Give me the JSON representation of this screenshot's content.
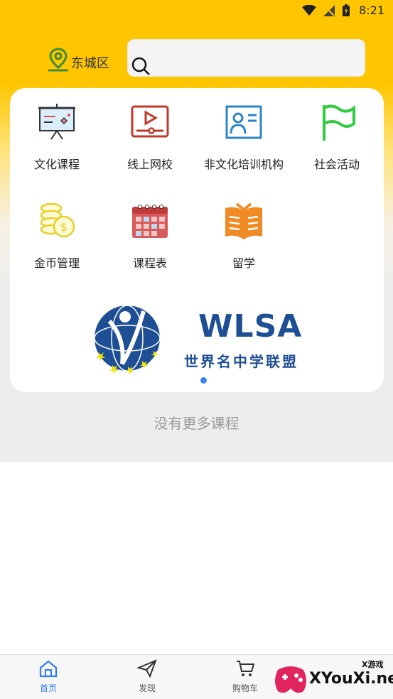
{
  "status": {
    "time": "8:21"
  },
  "header": {
    "location": "东城区",
    "search_placeholder": ""
  },
  "menu": [
    {
      "label": "文化课程",
      "icon": "presentation-board-icon"
    },
    {
      "label": "线上网校",
      "icon": "video-player-icon"
    },
    {
      "label": "非文化培训机构",
      "icon": "id-card-icon"
    },
    {
      "label": "社会活动",
      "icon": "flag-icon"
    },
    {
      "label": "金币管理",
      "icon": "coins-icon"
    },
    {
      "label": "课程表",
      "icon": "calendar-icon"
    },
    {
      "label": "留学",
      "icon": "open-book-icon"
    }
  ],
  "banner": {
    "title": "WLSA",
    "subtitle": "世界名中学联盟"
  },
  "footer_note": "没有更多课程",
  "nav": [
    {
      "label": "首页",
      "active": true
    },
    {
      "label": "发现",
      "active": false
    },
    {
      "label": "购物车",
      "active": false
    }
  ],
  "watermark": {
    "text": "XYouXi.net",
    "small": "X游戏"
  },
  "colors": {
    "accent": "#ffc600",
    "active_nav": "#2f7ef6",
    "banner_blue": "#1e4f94"
  }
}
